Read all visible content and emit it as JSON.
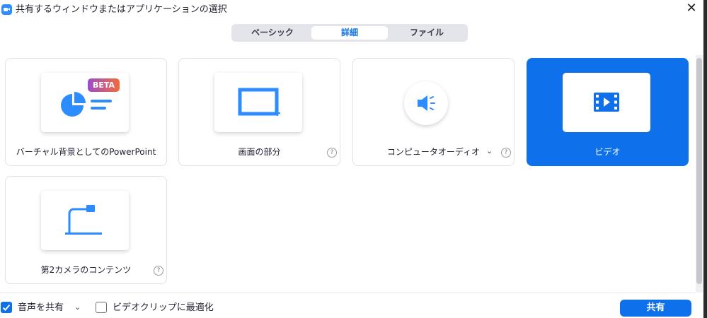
{
  "window": {
    "title": "共有するウィンドウまたはアプリケーションの選択",
    "close_glyph": "✕"
  },
  "tabs": [
    {
      "label": "ベーシック",
      "selected": false
    },
    {
      "label": "詳細",
      "selected": true
    },
    {
      "label": "ファイル",
      "selected": false
    }
  ],
  "cards": {
    "powerpoint": {
      "label": "バーチャル背景としてのPowerPoint",
      "badge": "BETA",
      "icon": "pie-chart-slides-icon"
    },
    "portion": {
      "label": "画面の部分",
      "icon": "screen-portion-icon",
      "help": "?"
    },
    "audio": {
      "label": "コンピュータオーディオ",
      "icon": "speaker-icon",
      "chevron": "⌄",
      "help": "?"
    },
    "video": {
      "label": "ビデオ",
      "icon": "film-play-icon",
      "selected": true
    },
    "camera2": {
      "label": "第2カメラのコンテンツ",
      "icon": "document-camera-icon",
      "help": "?"
    }
  },
  "footer": {
    "share_audio": {
      "label": "音声を共有",
      "checked": true,
      "chevron": "⌄"
    },
    "optimize_video": {
      "label": "ビデオクリップに最適化",
      "checked": false
    },
    "share_button": "共有"
  },
  "colors": {
    "accent": "#0E71EB",
    "app_icon": "#2D8CFF",
    "icon_blue": "#2D8CFF"
  }
}
